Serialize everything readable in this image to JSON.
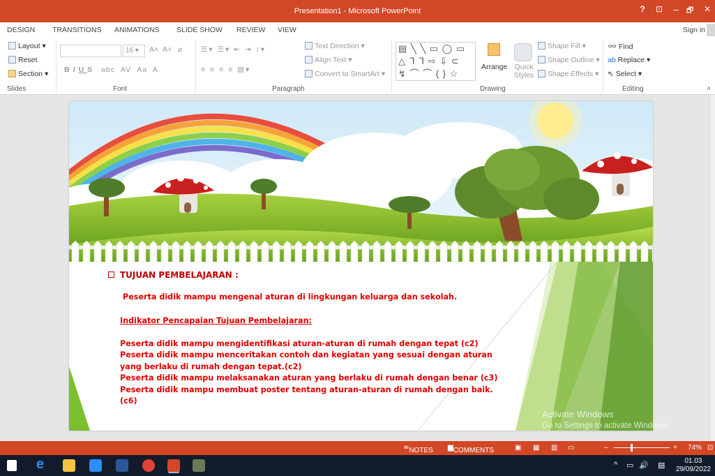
{
  "window": {
    "title": "Presentation1 - Microsoft PowerPoint",
    "controls": {
      "help": "?",
      "restore_ribbon": "⊡",
      "minimize": "–",
      "maximize": "🗗",
      "close": "✕"
    }
  },
  "tabs": [
    "DESIGN",
    "TRANSITIONS",
    "ANIMATIONS",
    "SLIDE SHOW",
    "REVIEW",
    "VIEW"
  ],
  "sign_in": "Sign in",
  "ribbon": {
    "slides": {
      "layout": "Layout",
      "reset": "Reset",
      "section": "Section",
      "label": "Slides"
    },
    "font": {
      "size": "16",
      "label": "Font",
      "buttons": [
        "B",
        "I",
        "U",
        "S",
        "abc",
        "AV",
        "Aa",
        "A"
      ]
    },
    "paragraph": {
      "text_direction": "Text Direction",
      "align_text": "Align Text",
      "convert_smartart": "Convert to SmartArt",
      "label": "Paragraph"
    },
    "drawing": {
      "arrange": "Arrange",
      "quick_styles": "Quick Styles",
      "shape_fill": "Shape Fill",
      "shape_outline": "Shape Outline",
      "shape_effects": "Shape Effects",
      "label": "Drawing"
    },
    "editing": {
      "find": "Find",
      "replace": "Replace",
      "select": "Select",
      "label": "Editing"
    }
  },
  "slide": {
    "heading": "TUJUAN PEMBELAJARAN :",
    "goal": "Peserta didik mampu mengenal aturan di lingkungan keluarga dan sekolah.",
    "indicator_title": "Indikator Pencapaian Tujuan Pembelajaran:",
    "indicators": [
      "Peserta didik mampu mengidentifikasi aturan-aturan di rumah dengan tepat  (c2)",
      "Peserta didik mampu menceritakan contoh dan kegiatan yang sesuai dengan aturan",
      "yang berlaku di rumah dengan tepat.(c2)",
      "Peserta didik mampu melaksanakan aturan yang berlaku di rumah dengan benar (c3)",
      "Peserta didik mampu membuat poster tentang aturan-aturan di rumah dengan baik.",
      "(c6)"
    ]
  },
  "watermark": {
    "line1": "Activate Windows",
    "line2": "Go to Settings to activate Windows."
  },
  "statusbar": {
    "notes": "NOTES",
    "comments": "COMMENTS",
    "zoom": "74%"
  },
  "taskbar": {
    "time": "01.03",
    "date": "29/09/2022"
  },
  "colors": {
    "accent": "#d24726",
    "slide_text": "#e00000",
    "heading": "#c00000",
    "taskbar": "#121b2b"
  }
}
